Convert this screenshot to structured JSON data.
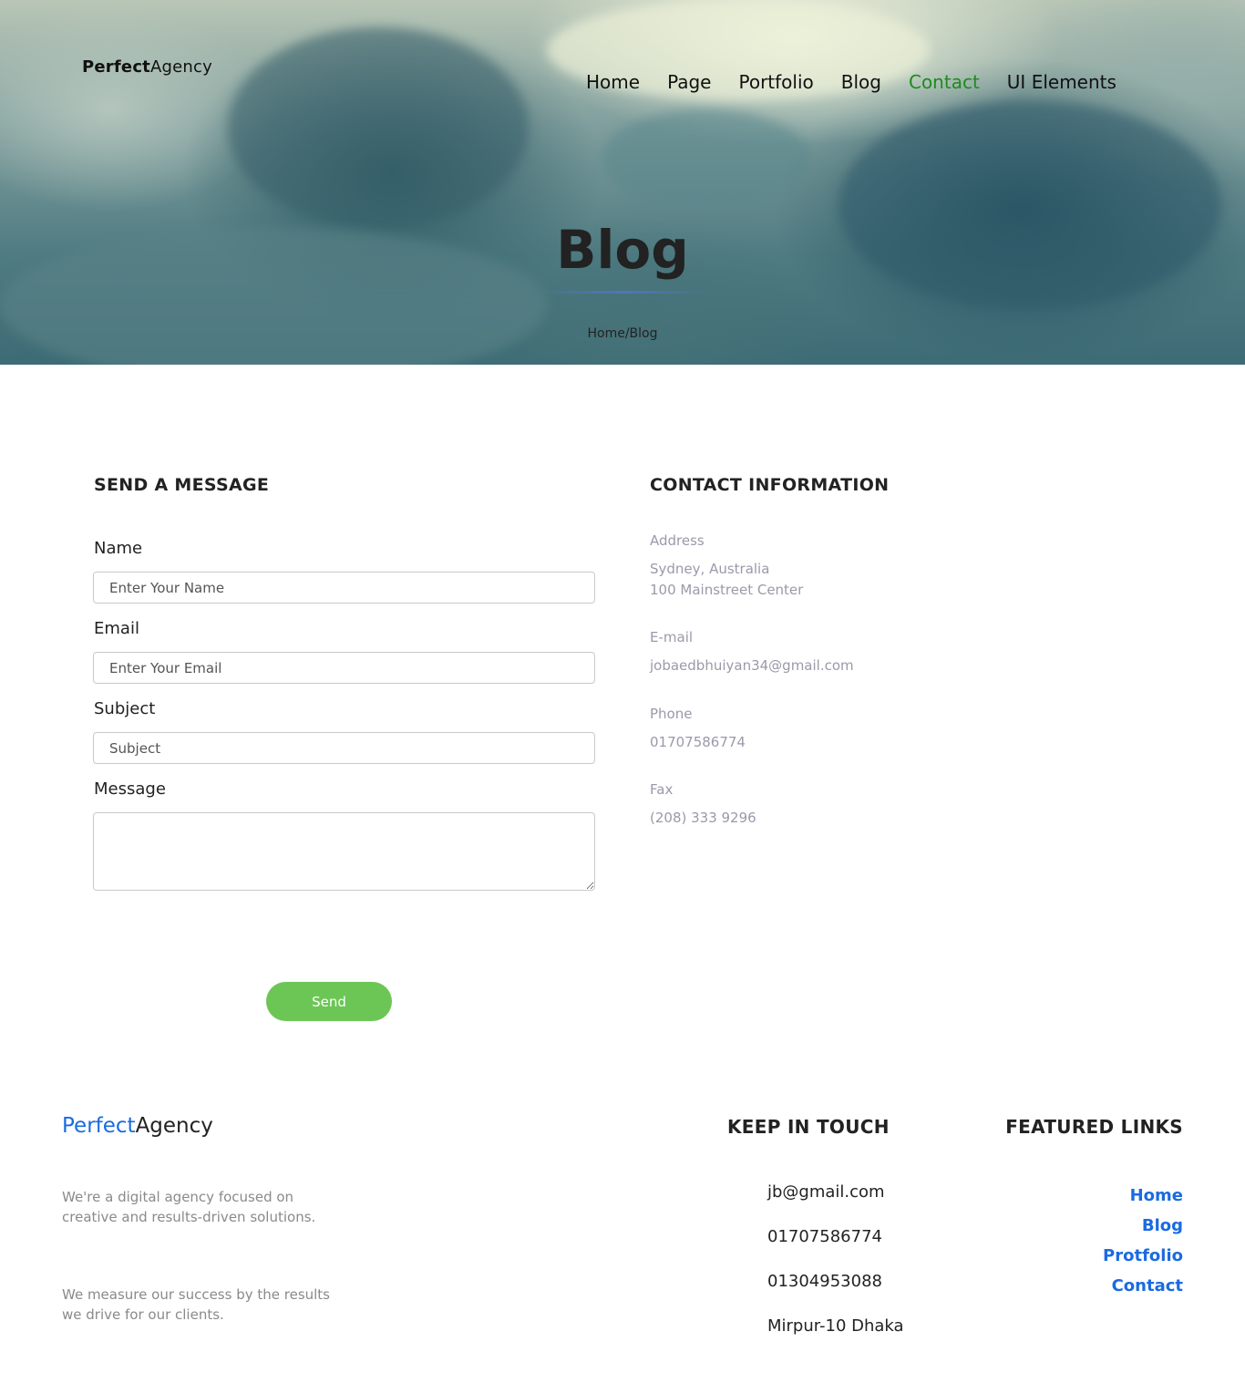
{
  "header": {
    "brand_bold": "Perfect",
    "brand_light": "Agency",
    "nav": [
      {
        "label": "Home"
      },
      {
        "label": "Page"
      },
      {
        "label": "Portfolio"
      },
      {
        "label": "Blog"
      },
      {
        "label": "Contact"
      },
      {
        "label": "UI Elements"
      }
    ],
    "active_nav": "Contact",
    "active_color": "#1f8a1f"
  },
  "hero": {
    "title": "Blog",
    "breadcrumb_home": "Home",
    "breadcrumb_sep": "/",
    "breadcrumb_current": "Blog"
  },
  "form": {
    "title": "SEND A MESSAGE",
    "name_label": "Name",
    "name_placeholder": "Enter Your Name",
    "email_label": "Email",
    "email_placeholder": "Enter Your Email",
    "subject_label": "Subject",
    "subject_placeholder": "Subject",
    "message_label": "Message",
    "message_value": "",
    "send_label": "Send",
    "send_color": "#6cc655"
  },
  "contact": {
    "title": "CONTACT INFORMATION",
    "address_label": "Address",
    "address_line1": "Sydney, Australia",
    "address_line2": "100 Mainstreet Center",
    "email_label": "E-mail",
    "email_value": "jobaedbhuiyan34@gmail.com",
    "phone_label": "Phone",
    "phone_value": "01707586774",
    "fax_label": "Fax",
    "fax_value": "(208) 333 9296"
  },
  "footer": {
    "brand_blue": "Perfect",
    "brand_dark": "Agency",
    "brand_color": "#1a6be0",
    "about_1_line1": "We're a digital agency focused on",
    "about_1_line2": "creative and results-driven solutions.",
    "about_2_line1": "We measure our success by the results",
    "about_2_line2": "we drive for our clients.",
    "touch_title": "KEEP IN TOUCH",
    "touch_items": [
      "jb@gmail.com",
      "01707586774",
      "01304953088",
      "Mirpur-10 Dhaka"
    ],
    "links_title": "FEATURED LINKS",
    "links": [
      "Home",
      "Blog",
      "Protfolio",
      "Contact"
    ]
  }
}
